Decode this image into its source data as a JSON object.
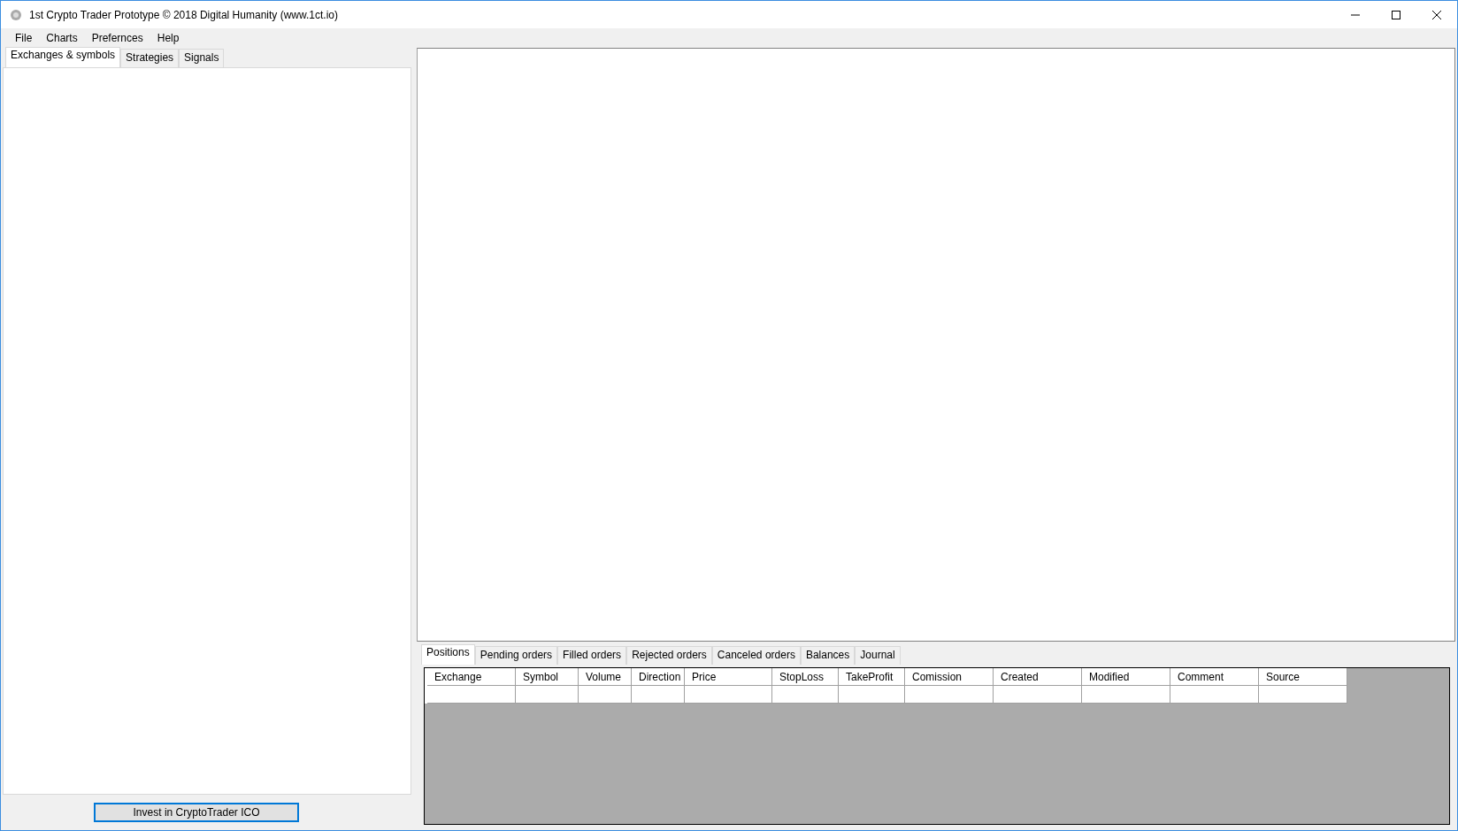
{
  "window": {
    "title": "1st Crypto Trader Prototype © 2018 Digital Humanity (www.1ct.io)"
  },
  "menu": [
    "File",
    "Charts",
    "Prefernces",
    "Help"
  ],
  "left_tabs": [
    {
      "label": "Exchanges & symbols",
      "selected": true
    },
    {
      "label": "Strategies",
      "selected": false
    },
    {
      "label": "Signals",
      "selected": false
    }
  ],
  "invest_button": "Invest in CryptoTrader ICO",
  "bottom_tabs": [
    {
      "label": "Positions",
      "selected": true
    },
    {
      "label": "Pending orders",
      "selected": false
    },
    {
      "label": "Filled orders",
      "selected": false
    },
    {
      "label": "Rejected orders",
      "selected": false
    },
    {
      "label": "Canceled orders",
      "selected": false
    },
    {
      "label": "Balances",
      "selected": false
    },
    {
      "label": "Journal",
      "selected": false
    }
  ],
  "table": {
    "columns": [
      "Exchange",
      "Symbol",
      "Volume",
      "Direction",
      "Price",
      "StopLoss",
      "TakeProfit",
      "Comission",
      "Created",
      "Modified",
      "Comment",
      "Source"
    ]
  }
}
